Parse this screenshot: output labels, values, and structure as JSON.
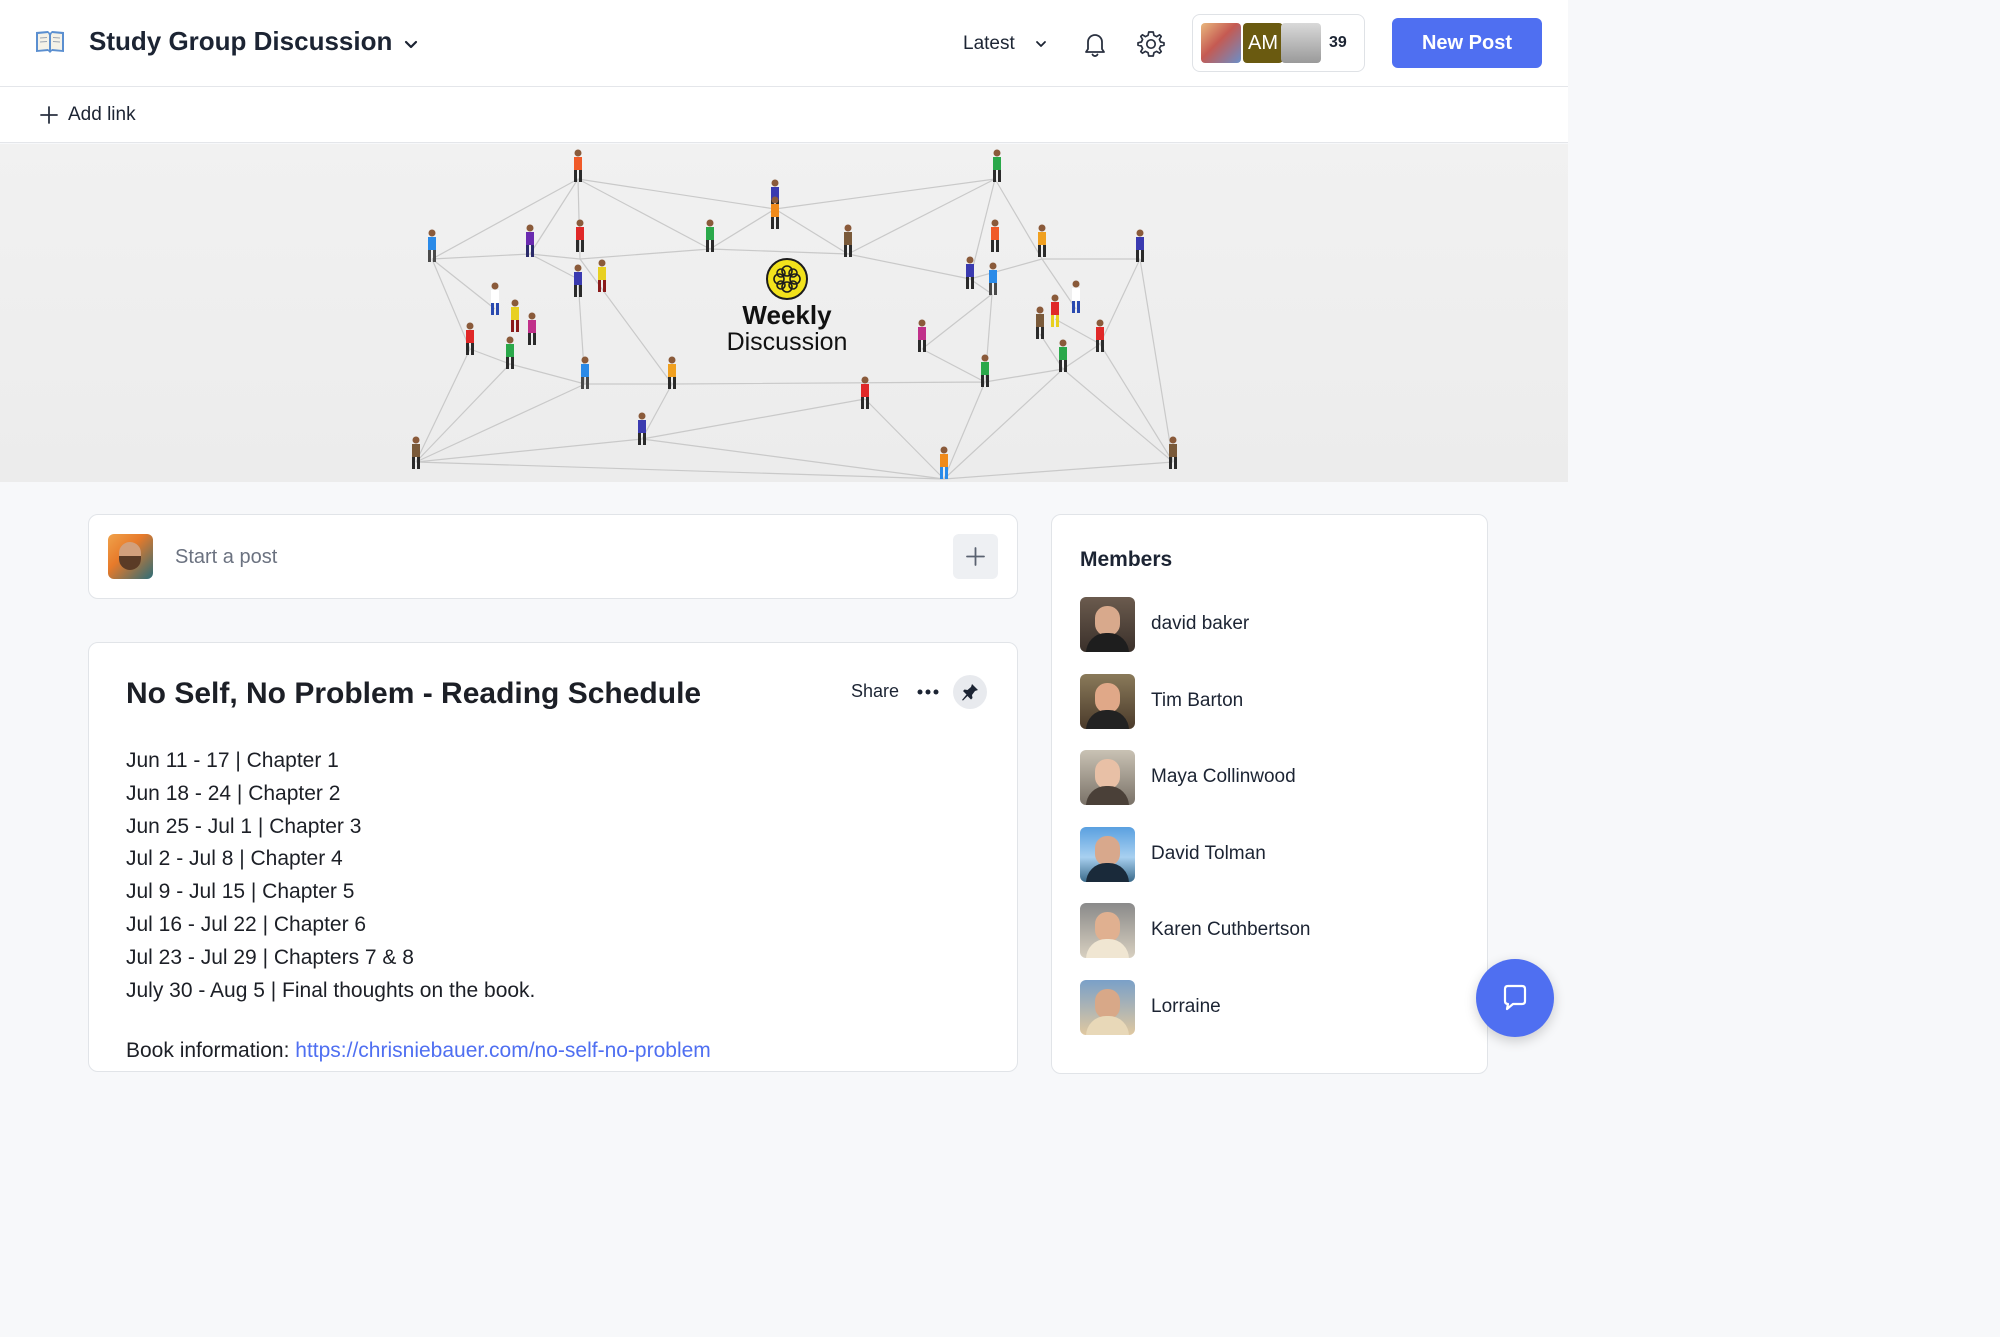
{
  "header": {
    "space_title": "Study Group Discussion",
    "sort_label": "Latest",
    "member_initials": "AM",
    "member_count": "39",
    "new_post_label": "New Post"
  },
  "linkbar": {
    "add_link_label": "Add link"
  },
  "banner": {
    "title_line1": "Weekly",
    "title_line2": "Discussion"
  },
  "composer": {
    "placeholder": "Start a post"
  },
  "post": {
    "title": "No Self, No Problem - Reading Schedule",
    "share_label": "Share",
    "schedule": [
      "Jun 11 - 17 | Chapter 1",
      "Jun 18 - 24 | Chapter 2",
      "Jun 25 - Jul 1 | Chapter 3",
      "Jul 2 - Jul 8 | Chapter 4",
      "Jul 9 - Jul 15 | Chapter 5",
      "Jul 16 - Jul 22 | Chapter 6",
      "Jul 23 - Jul 29 | Chapters 7 & 8",
      "July 30 - Aug 5 | Final thoughts on the book."
    ],
    "book_info_prefix": "Book information:",
    "book_info_link": "https://chrisniebauer.com/no-self-no-problem"
  },
  "members": {
    "title": "Members",
    "list": [
      {
        "name": "david baker"
      },
      {
        "name": "Tim Barton"
      },
      {
        "name": "Maya Collinwood"
      },
      {
        "name": "David Tolman"
      },
      {
        "name": "Karen Cuthbertson"
      },
      {
        "name": "Lorraine"
      }
    ]
  },
  "colors": {
    "accent": "#4f6ff1",
    "text": "#1c2433",
    "logo_yellow": "#f2e21c"
  },
  "icons": {
    "space": "book-icon",
    "title_dropdown": "chevron-down-icon",
    "sort_dropdown": "chevron-down-icon",
    "notifications": "bell-icon",
    "settings": "gear-icon",
    "add_link": "plus-icon",
    "composer_add": "plus-icon",
    "post_more": "ellipsis-icon",
    "post_pin": "pin-icon",
    "chat": "chat-bubble-icon"
  }
}
